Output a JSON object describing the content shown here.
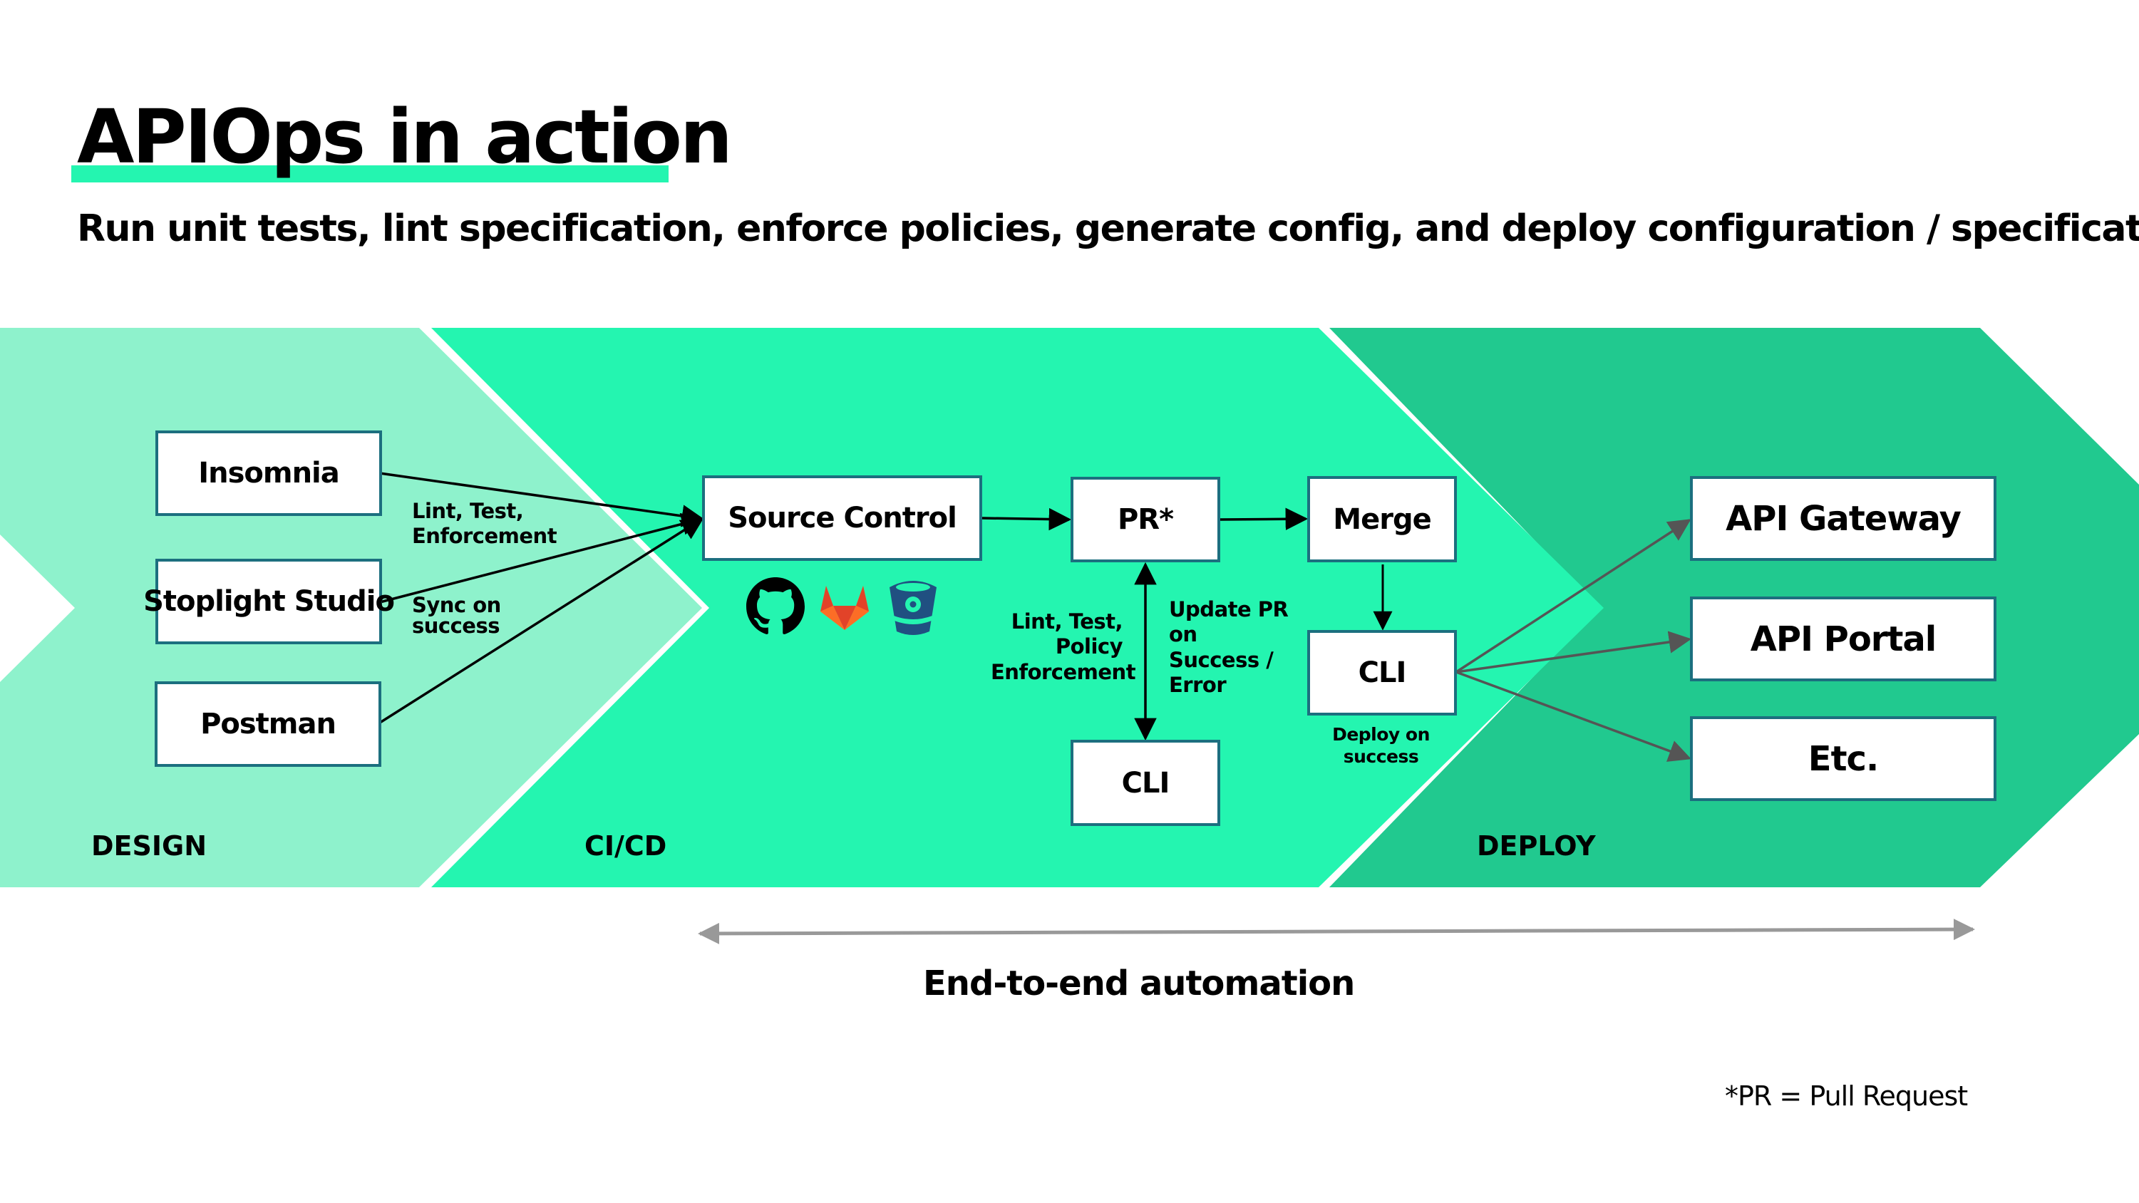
{
  "header": {
    "title": "APIOps in action",
    "subtitle": "Run unit tests, lint specification, enforce policies, generate config, and deploy configuration / specification"
  },
  "colors": {
    "design_stage": "#8ef2cc",
    "cicd_stage": "#24f5b0",
    "deploy_stage": "#21c98f",
    "box_border": "#1c6f7f",
    "accent_underline": "#24f5b0",
    "automation_arrow": "#999999",
    "deploy_arrow": "#555555"
  },
  "stages": {
    "design": {
      "label": "DESIGN"
    },
    "cicd": {
      "label": "CI/CD"
    },
    "deploy": {
      "label": "DEPLOY"
    }
  },
  "design_tools": [
    {
      "label": "Insomnia"
    },
    {
      "label": "Stoplight Studio"
    },
    {
      "label": "Postman"
    }
  ],
  "design_edge_labels": {
    "lint": "Lint, Test,\nEnforcement",
    "sync": "Sync on\nsuccess"
  },
  "cicd": {
    "source_control": "Source Control",
    "source_icons": [
      "github-icon",
      "gitlab-icon",
      "bitbucket-icon"
    ],
    "pr": "PR*",
    "merge": "Merge",
    "cli_test": "CLI",
    "cli_deploy": "CLI",
    "pr_left_label": "Lint, Test,\nPolicy\nEnforcement",
    "pr_right_label": "Update PR\non\nSuccess /\nError",
    "deploy_label": "Deploy on\nsuccess"
  },
  "deploy_targets": [
    {
      "label": "API Gateway"
    },
    {
      "label": "API Portal"
    },
    {
      "label": "Etc."
    }
  ],
  "automation": {
    "label": "End-to-end automation"
  },
  "footnote": "*PR = Pull Request"
}
